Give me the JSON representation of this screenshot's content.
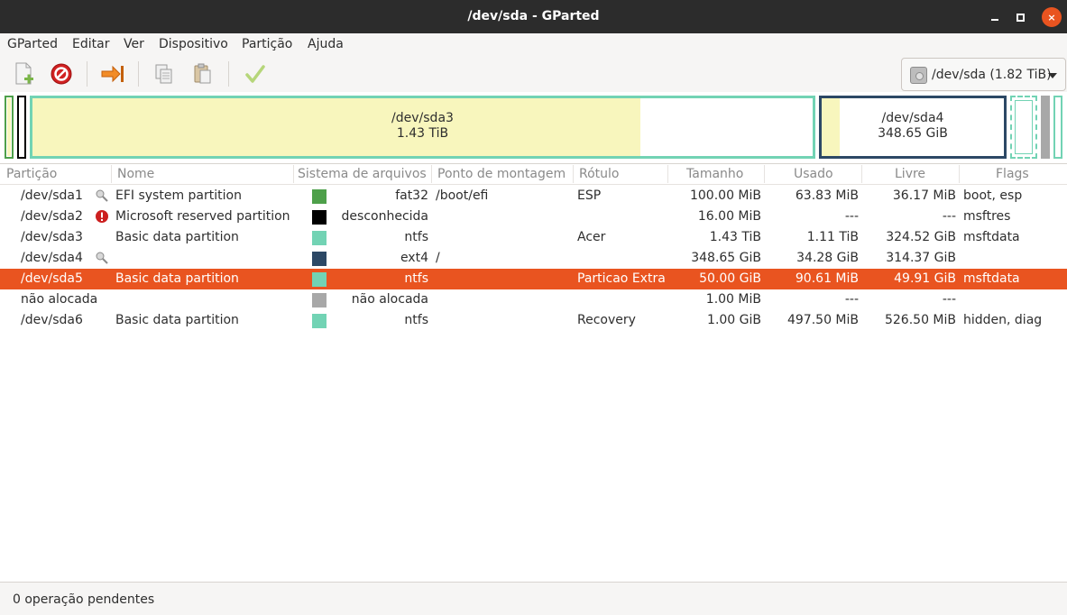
{
  "window": {
    "title": "/dev/sda - GParted",
    "close_glyph": "×"
  },
  "menu": [
    "GParted",
    "Editar",
    "Ver",
    "Dispositivo",
    "Partição",
    "Ajuda"
  ],
  "toolbar": {
    "icons": [
      "new-partition-icon",
      "delete-icon",
      "resize-move-icon",
      "copy-icon",
      "paste-icon",
      "apply-icon"
    ],
    "device": "/dev/sda (1.82 TiB)"
  },
  "diskmap": {
    "sda3": {
      "name": "/dev/sda3",
      "size": "1.43 TiB"
    },
    "sda4": {
      "name": "/dev/sda4",
      "size": "348.65 GiB"
    }
  },
  "table": {
    "headers": [
      "Partição",
      "Nome",
      "Sistema de arquivos",
      "Ponto de montagem",
      "Rótulo",
      "Tamanho",
      "Usado",
      "Livre",
      "Flags"
    ],
    "rows": [
      {
        "partition": "/dev/sda1",
        "icon": "key-icon",
        "name": "EFI system partition",
        "fs_color": "#4ea04a",
        "fs": "fat32",
        "mount": "/boot/efi",
        "label": "ESP",
        "size": "100.00 MiB",
        "used": "63.83 MiB",
        "free": "36.17 MiB",
        "flags": "boot, esp"
      },
      {
        "partition": "/dev/sda2",
        "icon": "warning-icon",
        "name": "Microsoft reserved partition",
        "fs_color": "#000000",
        "fs": "desconhecida",
        "mount": "",
        "label": "",
        "size": "16.00 MiB",
        "used": "---",
        "free": "---",
        "flags": "msftres"
      },
      {
        "partition": "/dev/sda3",
        "icon": "",
        "name": "Basic data partition",
        "fs_color": "#72d3b4",
        "fs": "ntfs",
        "mount": "",
        "label": "Acer",
        "size": "1.43 TiB",
        "used": "1.11 TiB",
        "free": "324.52 GiB",
        "flags": "msftdata"
      },
      {
        "partition": "/dev/sda4",
        "icon": "key-icon",
        "name": "",
        "fs_color": "#2c4865",
        "fs": "ext4",
        "mount": "/",
        "label": "",
        "size": "348.65 GiB",
        "used": "34.28 GiB",
        "free": "314.37 GiB",
        "flags": ""
      },
      {
        "partition": "/dev/sda5",
        "icon": "",
        "name": "Basic data partition",
        "fs_color": "#72d3b4",
        "fs": "ntfs",
        "mount": "",
        "label": "Particao Extra",
        "size": "50.00 GiB",
        "used": "90.61 MiB",
        "free": "49.91 GiB",
        "flags": "msftdata",
        "selected": true
      },
      {
        "partition": "não alocada",
        "icon": "",
        "name": "",
        "fs_color": "#a8a8a8",
        "fs": "não alocada",
        "mount": "",
        "label": "",
        "size": "1.00 MiB",
        "used": "---",
        "free": "---",
        "flags": ""
      },
      {
        "partition": "/dev/sda6",
        "icon": "",
        "name": "Basic data partition",
        "fs_color": "#72d3b4",
        "fs": "ntfs",
        "mount": "",
        "label": "Recovery",
        "size": "1.00 GiB",
        "used": "497.50 MiB",
        "free": "526.50 MiB",
        "flags": "hidden, diag"
      }
    ]
  },
  "status": {
    "text": "0 operação pendentes"
  },
  "colors": {
    "accent": "#e95420",
    "ntfs": "#72d3b4",
    "ext4": "#2c4865",
    "fat32": "#4ea04a",
    "used_fill": "#f8f6bd"
  }
}
